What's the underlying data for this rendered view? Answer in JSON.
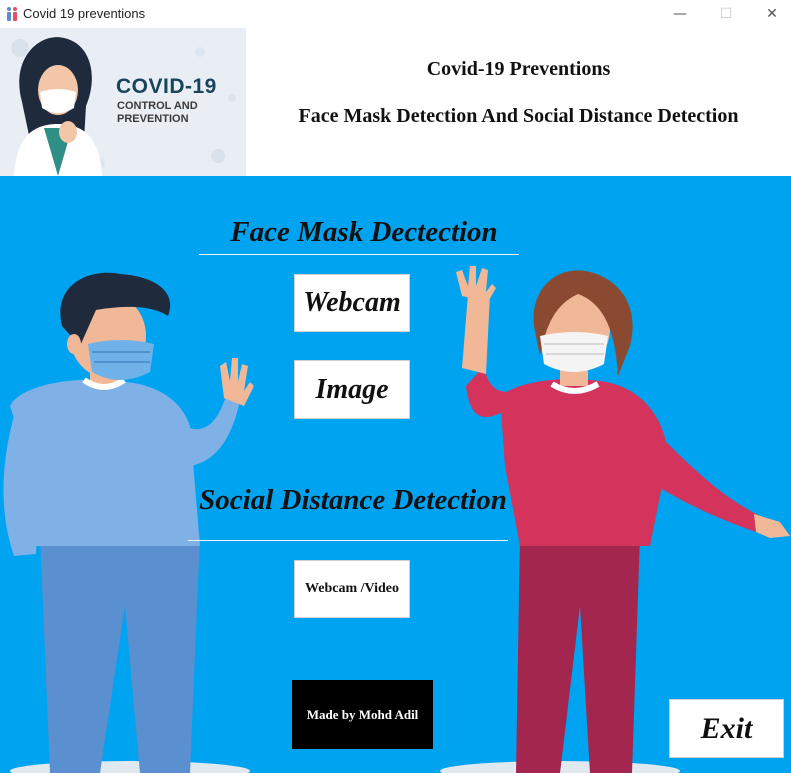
{
  "window": {
    "title": "Covid 19 preventions",
    "icon": "people-icon",
    "controls": {
      "minimize": "—",
      "maximize": "☐",
      "close": "✕"
    }
  },
  "header": {
    "banner": {
      "line1": "COVID-19",
      "line2": "CONTROL AND PREVENTION",
      "icon": "woman-coughing-mask-illustration"
    },
    "title": "Covid-19 Preventions",
    "subtitle": "Face Mask Detection And Social Distance Detection"
  },
  "main": {
    "background_color": "#00a3f0",
    "face_mask_section": {
      "title": "Face Mask Dectection",
      "buttons": {
        "webcam": "Webcam",
        "image": "Image"
      }
    },
    "social_distance_section": {
      "title": "Social Distance Detection",
      "buttons": {
        "webcam_video": "Webcam /Video"
      }
    },
    "credit": "Made by Mohd Adil",
    "exit_label": "Exit"
  }
}
